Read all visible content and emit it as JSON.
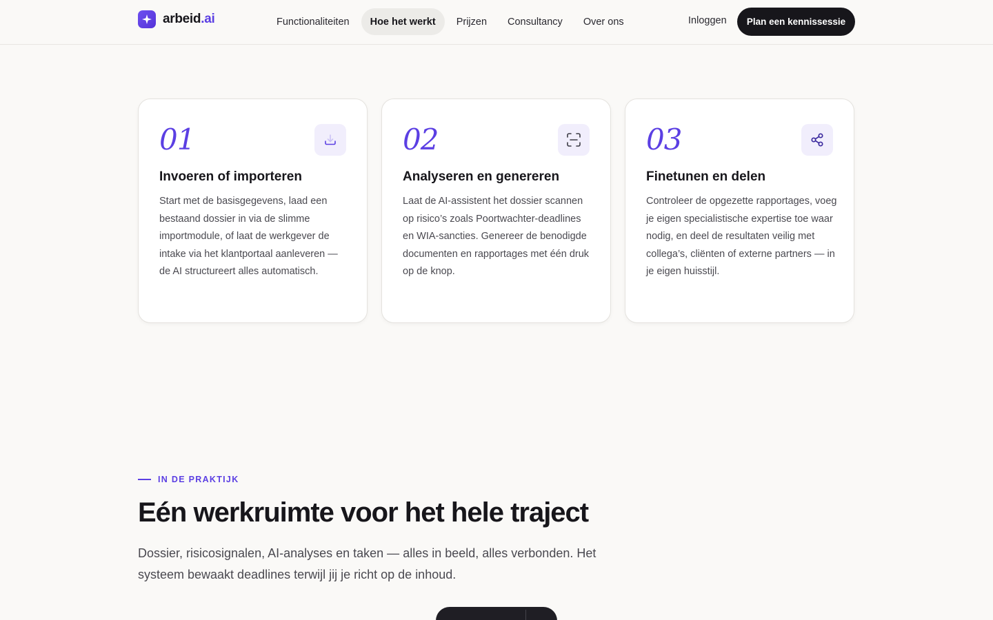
{
  "header": {
    "logo_text": "arbeid",
    "logo_suffix": ".ai",
    "nav": [
      {
        "label": "Functionaliteiten"
      },
      {
        "label": "Hoe het werkt"
      },
      {
        "label": "Prijzen"
      },
      {
        "label": "Consultancy"
      },
      {
        "label": "Over ons"
      }
    ],
    "login_label": "Inloggen",
    "cta_label": "Plan een kennissessie"
  },
  "steps": [
    {
      "number": "01",
      "icon": "download-tray-icon",
      "title": "Invoeren of importeren",
      "body": "Start met de basisgegevens, laad een bestaand dossier in via de slimme importmodule, of laat de werkgever de intake via het klantportaal aanleveren — de AI structureert alles automatisch."
    },
    {
      "number": "02",
      "icon": "scan-icon",
      "title": "Analyseren en genereren",
      "body": "Laat de AI-assistent het dossier scannen op risico’s zoals Poortwachter-deadlines en WIA-sancties. Genereer de benodigde documenten en rapportages met één druk op de knop."
    },
    {
      "number": "03",
      "icon": "share-icon",
      "title": "Finetunen en delen",
      "body": "Controleer de opgezette rapportages, voeg je eigen specialistische expertise toe waar nodig, en deel de resultaten veilig met collega’s, cliënten of externe partners — in je eigen huisstijl."
    }
  ],
  "section": {
    "eyebrow": "IN DE PRAKTIJK",
    "heading": "Eén werkruimte voor het hele traject",
    "lead": "Dossier, risicosignalen, AI-analyses en taken — alles in beeld, alles verbonden. Het systeem bewaakt deadlines terwijl jij je richt op de inhoud."
  },
  "colors": {
    "accent": "#5b3fe3",
    "background": "#faf9f7",
    "dark": "#17161b"
  }
}
